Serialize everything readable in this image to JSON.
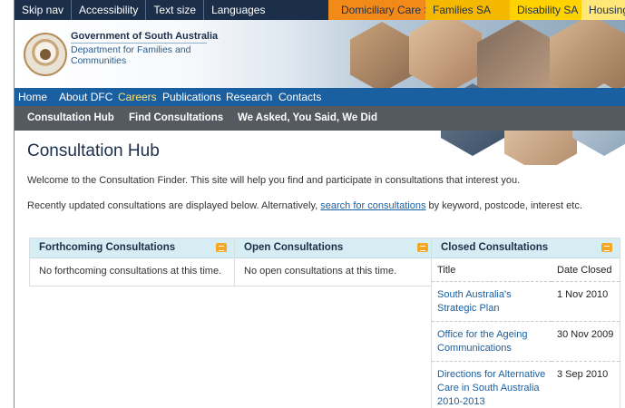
{
  "top_links": [
    "Skip nav",
    "Accessibility",
    "Text size",
    "Languages"
  ],
  "tabs": [
    "Domiciliary Care SA",
    "Families SA",
    "Disability SA",
    "Housing S"
  ],
  "header": {
    "gov": "Government of South Australia",
    "dept": "Department for Families and Communities"
  },
  "nav": {
    "primary": [
      "Home",
      "About DFC",
      "Careers",
      "Publications",
      "Research",
      "Contacts"
    ],
    "secondary": [
      "Consultation Hub",
      "Find Consultations",
      "We Asked, You Said, We Did"
    ]
  },
  "page": {
    "title": "Consultation Hub",
    "intro": "Welcome to the Consultation Finder. This site will help you find and participate in consultations that interest you.",
    "recent_prefix": "Recently updated consultations are displayed below. Alternatively, ",
    "recent_link": "search for consultations",
    "recent_suffix": " by keyword, postcode, interest etc."
  },
  "panels": {
    "forthcoming": {
      "title": "Forthcoming Consultations",
      "text": "No forthcoming consultations at this time."
    },
    "open": {
      "title": "Open Consultations",
      "text": "No open consultations at this time."
    },
    "closed": {
      "title": "Closed Consultations",
      "columns": [
        "Title",
        "Date Closed"
      ],
      "rows": [
        {
          "title": "South Australia's Strategic Plan",
          "date": "1 Nov 2010"
        },
        {
          "title": "Office for the Ageing Communications",
          "date": "30 Nov 2009"
        },
        {
          "title": "Directions for Alternative Care in South Australia 2010-2013",
          "date": "3 Sep 2010"
        }
      ]
    }
  },
  "colors": {
    "topbar": "#1c2f4a",
    "nav_primary": "#1a5fa0",
    "nav_secondary": "#555a60",
    "panel_head": "#d6edf3",
    "link": "#1a5fa0"
  }
}
